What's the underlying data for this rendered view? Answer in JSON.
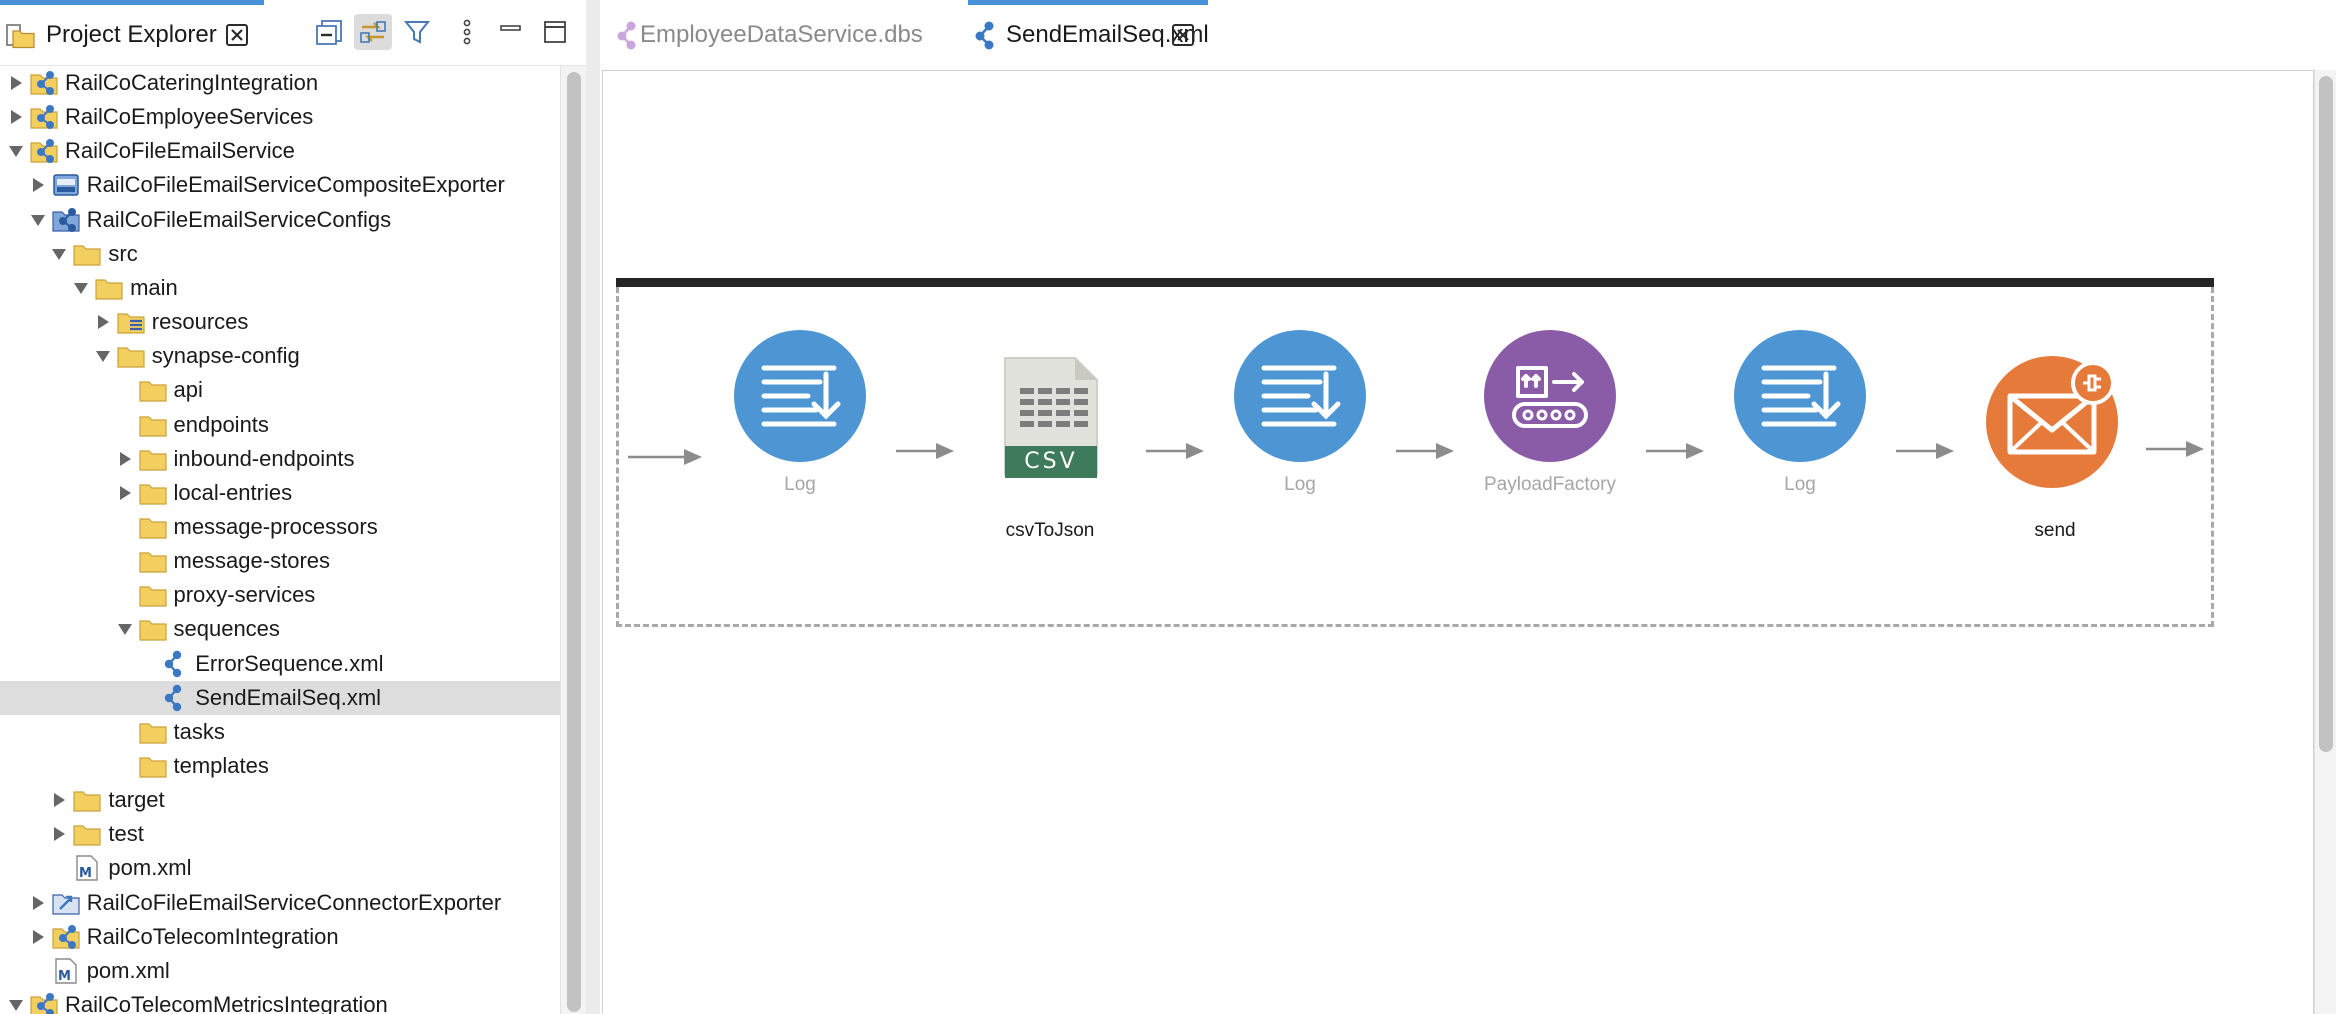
{
  "left_panel": {
    "tab_label": "Project Explorer",
    "toolbar": {
      "collapse_all": "collapse-all",
      "link_with_editor": "link-with-editor",
      "filter": "filter",
      "view_menu": "view-menu",
      "minimize": "minimize",
      "maximize": "maximize"
    },
    "tree": [
      {
        "label": "RailCoCateringIntegration",
        "icon": "project-icon",
        "twisty": "collapsed",
        "level": 0
      },
      {
        "label": "RailCoEmployeeServices",
        "icon": "project-icon",
        "twisty": "collapsed",
        "level": 0
      },
      {
        "label": "RailCoFileEmailService",
        "icon": "project-icon",
        "twisty": "expanded",
        "level": 0
      },
      {
        "label": "RailCoFileEmailServiceCompositeExporter",
        "icon": "composite-exporter-icon",
        "twisty": "collapsed",
        "level": 1
      },
      {
        "label": "RailCoFileEmailServiceConfigs",
        "icon": "config-project-icon",
        "twisty": "expanded",
        "level": 1
      },
      {
        "label": "src",
        "icon": "folder-icon",
        "twisty": "expanded",
        "level": 2
      },
      {
        "label": "main",
        "icon": "folder-icon",
        "twisty": "expanded",
        "level": 3
      },
      {
        "label": "resources",
        "icon": "resources-folder-icon",
        "twisty": "collapsed",
        "level": 4
      },
      {
        "label": "synapse-config",
        "icon": "folder-icon",
        "twisty": "expanded",
        "level": 4
      },
      {
        "label": "api",
        "icon": "folder-icon",
        "twisty": "none",
        "level": 5
      },
      {
        "label": "endpoints",
        "icon": "folder-icon",
        "twisty": "none",
        "level": 5
      },
      {
        "label": "inbound-endpoints",
        "icon": "folder-icon",
        "twisty": "collapsed",
        "level": 5
      },
      {
        "label": "local-entries",
        "icon": "folder-icon",
        "twisty": "collapsed",
        "level": 5
      },
      {
        "label": "message-processors",
        "icon": "folder-icon",
        "twisty": "none",
        "level": 5
      },
      {
        "label": "message-stores",
        "icon": "folder-icon",
        "twisty": "none",
        "level": 5
      },
      {
        "label": "proxy-services",
        "icon": "folder-icon",
        "twisty": "none",
        "level": 5
      },
      {
        "label": "sequences",
        "icon": "folder-icon",
        "twisty": "expanded",
        "level": 5
      },
      {
        "label": "ErrorSequence.xml",
        "icon": "sequence-file-icon",
        "twisty": "none",
        "level": 6
      },
      {
        "label": "SendEmailSeq.xml",
        "icon": "sequence-file-icon",
        "twisty": "none",
        "level": 6,
        "selected": true
      },
      {
        "label": "tasks",
        "icon": "folder-icon",
        "twisty": "none",
        "level": 5
      },
      {
        "label": "templates",
        "icon": "folder-icon",
        "twisty": "none",
        "level": 5
      },
      {
        "label": "target",
        "icon": "folder-icon",
        "twisty": "collapsed",
        "level": 2
      },
      {
        "label": "test",
        "icon": "folder-icon",
        "twisty": "collapsed",
        "level": 2
      },
      {
        "label": "pom.xml",
        "icon": "maven-file-icon",
        "twisty": "none",
        "level": 2
      },
      {
        "label": "RailCoFileEmailServiceConnectorExporter",
        "icon": "connector-exporter-icon",
        "twisty": "collapsed",
        "level": 1
      },
      {
        "label": "RailCoTelecomIntegration",
        "icon": "project-icon",
        "twisty": "collapsed",
        "level": 1
      },
      {
        "label": "pom.xml",
        "icon": "maven-file-icon",
        "twisty": "none",
        "level": 1
      },
      {
        "label": "RailCoTelecomMetricsIntegration",
        "icon": "project-icon",
        "twisty": "expanded",
        "level": 0
      }
    ]
  },
  "editor": {
    "tabs": [
      {
        "label": "EmployeeDataService.dbs",
        "icon": "dataservice-icon",
        "active": false
      },
      {
        "label": "SendEmailSeq.xml",
        "icon": "sequence-file-icon",
        "active": true
      }
    ],
    "mediators": [
      {
        "type": "log",
        "label": "Log",
        "icon": "log-mediator-icon",
        "color": "#4d95d3"
      },
      {
        "type": "csv",
        "label": "csvToJson",
        "icon": "csv-mediator-icon",
        "badge": "CSV",
        "color": "#3e7b5d"
      },
      {
        "type": "log",
        "label": "Log",
        "icon": "log-mediator-icon",
        "color": "#4d95d3"
      },
      {
        "type": "payload",
        "label": "PayloadFactory",
        "icon": "payload-factory-icon",
        "color": "#8a5ba6"
      },
      {
        "type": "log",
        "label": "Log",
        "icon": "log-mediator-icon",
        "color": "#4d95d3"
      },
      {
        "type": "send",
        "label": "send",
        "icon": "email-connector-icon",
        "color": "#e57a3a"
      }
    ]
  },
  "colors": {
    "accent": "#4a90d9",
    "folder": "#f3cf5f",
    "selection": "#dddddd",
    "log": "#4d95d3",
    "payload": "#8a5ba6",
    "send": "#e57a3a",
    "csv_badge": "#3e7b5d"
  }
}
